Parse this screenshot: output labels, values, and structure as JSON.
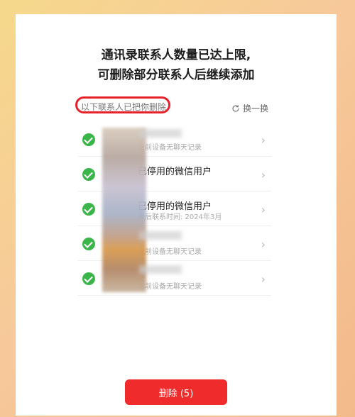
{
  "dialog": {
    "line1": "通讯录联系人数量已达上限,",
    "line2": "可删除部分联系人后继续添加",
    "section_label": "以下联系人已把你删除",
    "refresh_label": "换一换",
    "delete_label": "删除 (5)"
  },
  "contacts": [
    {
      "name": "",
      "sub": "当前设备无聊天记录"
    },
    {
      "name": "已停用的微信用户",
      "sub": ""
    },
    {
      "name": "已停用的微信用户",
      "sub": "最后联系时间: 2024年3月"
    },
    {
      "name": "",
      "sub": "当前设备无聊天记录"
    },
    {
      "name": "",
      "sub": "当前设备无聊天记录"
    }
  ],
  "colors": {
    "accent": "#ef2b2b",
    "check": "#3bb54a",
    "highlight_ring": "#e8212b"
  },
  "icons": {
    "row_check": "check-circle-icon",
    "row_chevron": "chevron-right-icon",
    "refresh": "refresh-icon"
  }
}
